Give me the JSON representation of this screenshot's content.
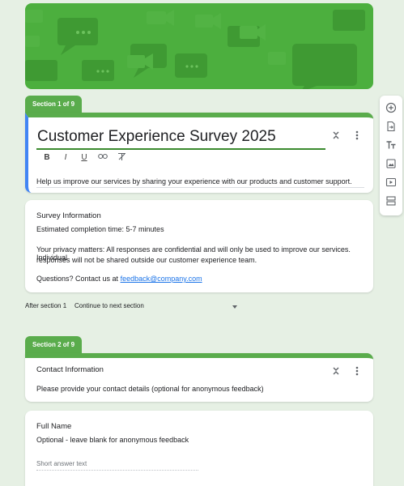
{
  "sections": [
    {
      "tab_label": "Section 1 of 9",
      "title": "Customer Experience Survey 2025",
      "description": "Help us improve our services by sharing your experience with our products and customer support.",
      "format_buttons": [
        "B",
        "I",
        "U"
      ]
    },
    {
      "tab_label": "Section 2 of 9",
      "title": "Contact Information",
      "description": "Please provide your contact details (optional for anonymous feedback)"
    }
  ],
  "survey_info": {
    "title": "Survey Information",
    "completion": "Estimated completion time: 5-7 minutes",
    "privacy_line1": "Your privacy matters: All responses are confidential and will only be used to improve our services. Individual",
    "privacy_line2": "responses will not be shared outside our customer experience team.",
    "contact_prefix": "Questions? Contact us at ",
    "contact_email": "feedback@company.com"
  },
  "after_section": {
    "label": "After section 1",
    "value": "Continue to next section"
  },
  "full_name_question": {
    "title": "Full Name",
    "description": "Optional - leave blank for anonymous feedback",
    "placeholder": "Short answer text"
  },
  "colors": {
    "accent": "#5aac4c",
    "banner": "#4caf3e",
    "active_border": "#4285f4",
    "link": "#1a73e8"
  },
  "sidebar_icons": [
    "add-question-icon",
    "import-questions-icon",
    "add-title-icon",
    "add-image-icon",
    "add-video-icon",
    "add-section-icon"
  ]
}
